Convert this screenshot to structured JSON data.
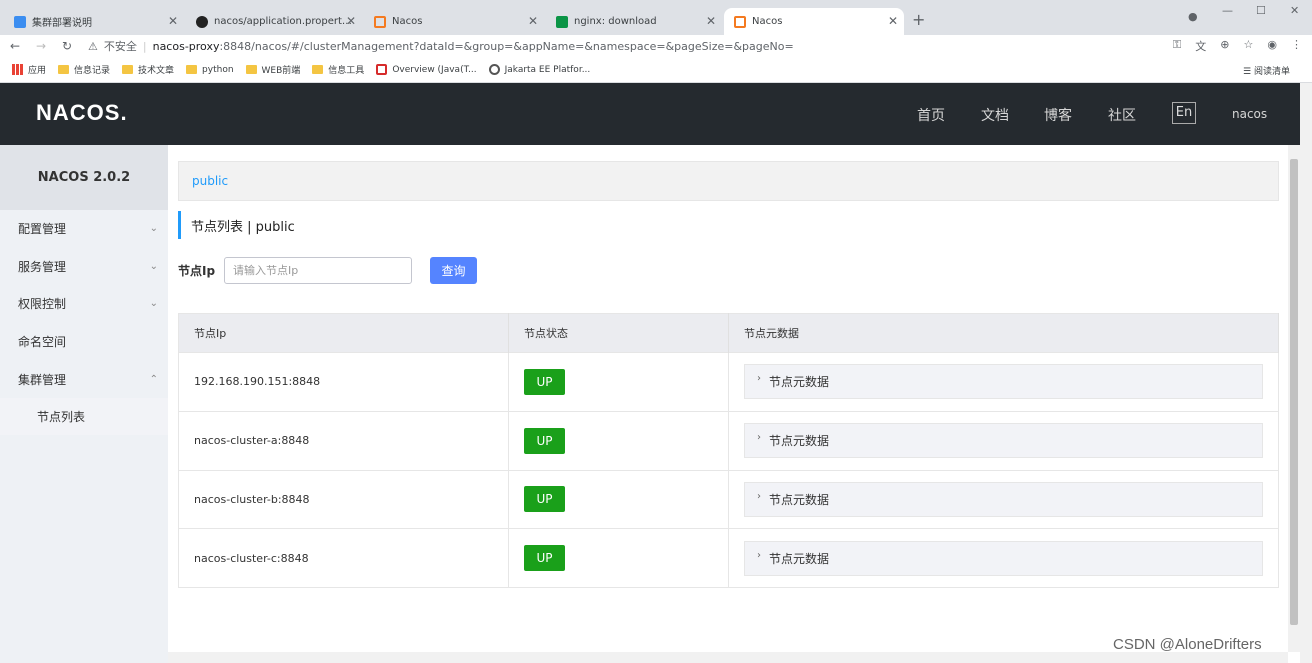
{
  "browser": {
    "tabs": [
      {
        "title": "集群部署说明",
        "icon": "cloud-icon",
        "active": false
      },
      {
        "title": "nacos/application.properties",
        "icon": "github-icon",
        "active": false
      },
      {
        "title": "Nacos",
        "icon": "nacos-icon",
        "active": false
      },
      {
        "title": "nginx: download",
        "icon": "nginx-icon",
        "active": false
      },
      {
        "title": "Nacos",
        "icon": "nacos-icon",
        "active": true
      }
    ],
    "new_tab": "+",
    "address": {
      "warning": "不安全",
      "host": "nacos-proxy",
      "path": ":8848/nacos/#/clusterManagement?dataId=&group=&appName=&namespace=&pageSize=&pageNo="
    },
    "bookmarks": [
      {
        "label": "应用",
        "kind": "apps"
      },
      {
        "label": "信息记录",
        "kind": "folder"
      },
      {
        "label": "技术文章",
        "kind": "folder"
      },
      {
        "label": "python",
        "kind": "folder"
      },
      {
        "label": "WEB前端",
        "kind": "folder"
      },
      {
        "label": "信息工具",
        "kind": "folder"
      },
      {
        "label": "Overview (Java(T...",
        "kind": "page"
      },
      {
        "label": "Jakarta EE Platfor...",
        "kind": "page"
      }
    ],
    "reading_list": "阅读清单"
  },
  "header": {
    "logo": "NACOS.",
    "nav": [
      "首页",
      "文档",
      "博客",
      "社区"
    ],
    "lang": "En",
    "user": "nacos"
  },
  "sidebar": {
    "title": "NACOS 2.0.2",
    "items": [
      {
        "label": "配置管理",
        "chevron": "⌄"
      },
      {
        "label": "服务管理",
        "chevron": "⌄"
      },
      {
        "label": "权限控制",
        "chevron": "⌄"
      },
      {
        "label": "命名空间",
        "chevron": ""
      },
      {
        "label": "集群管理",
        "chevron": "⌃"
      }
    ],
    "sub_items": [
      "节点列表"
    ]
  },
  "main": {
    "namespace": "public",
    "heading": "节点列表  |  public",
    "search": {
      "label": "节点Ip",
      "placeholder": "请输入节点Ip",
      "button": "查询"
    },
    "table": {
      "headers": [
        "节点Ip",
        "节点状态",
        "节点元数据"
      ],
      "rows": [
        {
          "ip": "192.168.190.151:8848",
          "status": "UP",
          "meta": "节点元数据"
        },
        {
          "ip": "nacos-cluster-a:8848",
          "status": "UP",
          "meta": "节点元数据"
        },
        {
          "ip": "nacos-cluster-b:8848",
          "status": "UP",
          "meta": "节点元数据"
        },
        {
          "ip": "nacos-cluster-c:8848",
          "status": "UP",
          "meta": "节点元数据"
        }
      ]
    }
  },
  "watermark": "CSDN @AloneDrifters",
  "colors": {
    "accent": "#209bfa",
    "header_bg": "#252a2f",
    "up_green": "#1aa01a",
    "button_blue": "#5584ff"
  }
}
